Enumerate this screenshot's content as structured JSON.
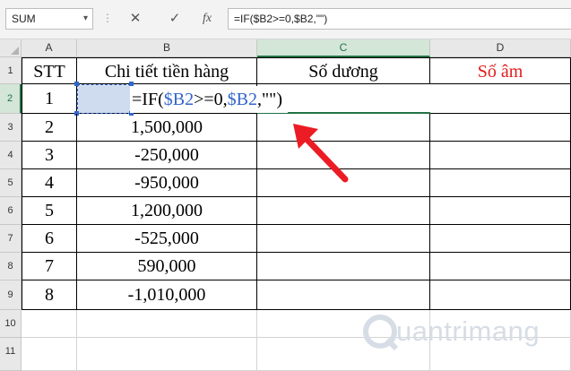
{
  "toolbar": {
    "name_box": "SUM",
    "cancel_icon": "✕",
    "enter_icon": "✓",
    "function_icon": "fx",
    "formula": "=IF($B2>=0,$B2,\"\")"
  },
  "columns": [
    "A",
    "B",
    "C",
    "D"
  ],
  "rows": [
    "1",
    "2",
    "3",
    "4",
    "5",
    "6",
    "7",
    "8",
    "9",
    "10",
    "11"
  ],
  "header_row": {
    "a": "STT",
    "b": "Chi tiết tiền hàng",
    "c": "Số dương",
    "d": "Số âm"
  },
  "editing": {
    "prefix": "=IF(",
    "ref1": "$B2",
    "mid": ">=0,",
    "ref2": "$B2",
    "suffix": ",\"\")"
  },
  "data_rows": [
    {
      "stt": "1",
      "amount": ""
    },
    {
      "stt": "2",
      "amount": "1,500,000"
    },
    {
      "stt": "3",
      "amount": "-250,000"
    },
    {
      "stt": "4",
      "amount": "-950,000"
    },
    {
      "stt": "5",
      "amount": "1,200,000"
    },
    {
      "stt": "6",
      "amount": "-525,000"
    },
    {
      "stt": "7",
      "amount": "590,000"
    },
    {
      "stt": "8",
      "amount": "-1,010,000"
    }
  ],
  "watermark": "uantrimang",
  "colors": {
    "accent": "#217346",
    "negative_header": "#e41b1b",
    "arrow": "#ec1c24",
    "reference": "#3366cc"
  }
}
